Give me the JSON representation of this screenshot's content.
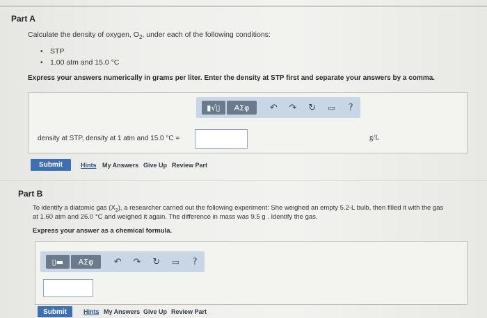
{
  "partA": {
    "title": "Part A",
    "prompt": "Calculate the density of oxygen, O",
    "prompt_sub": "2",
    "prompt_end": ", under each of the following conditions:",
    "conditions": [
      "STP",
      "1.00 atm and 15.0 °C"
    ],
    "instruction": "Express your answers numerically in grams per liter. Enter the density at STP first and separate your answers by a comma.",
    "label": "density at STP, density at 1 atm and 15.0 °C =",
    "units": "g/L",
    "submit": "Submit",
    "links": [
      "Hints",
      "My Answers",
      "Give Up",
      "Review Part"
    ],
    "toolbar": {
      "greek": "ΑΣφ",
      "help": "?"
    }
  },
  "partB": {
    "title": "Part B",
    "line1_a": "To identify a diatomic gas (X",
    "line1_sub": "2",
    "line1_b": "), a researcher carried out the following experiment: She weighed an empty 5.2-L bulb, then filled it with the gas",
    "line2": "at 1.60 atm and 26.0 °C and weighed it again. The difference in mass was 9.5 g . Identify the gas.",
    "instruction": "Express your answer as a chemical formula.",
    "submit": "Submit",
    "links": [
      "Hints",
      "My Answers",
      "Give Up",
      "Review Part"
    ],
    "toolbar": {
      "greek": "ΑΣφ",
      "help": "?"
    }
  }
}
